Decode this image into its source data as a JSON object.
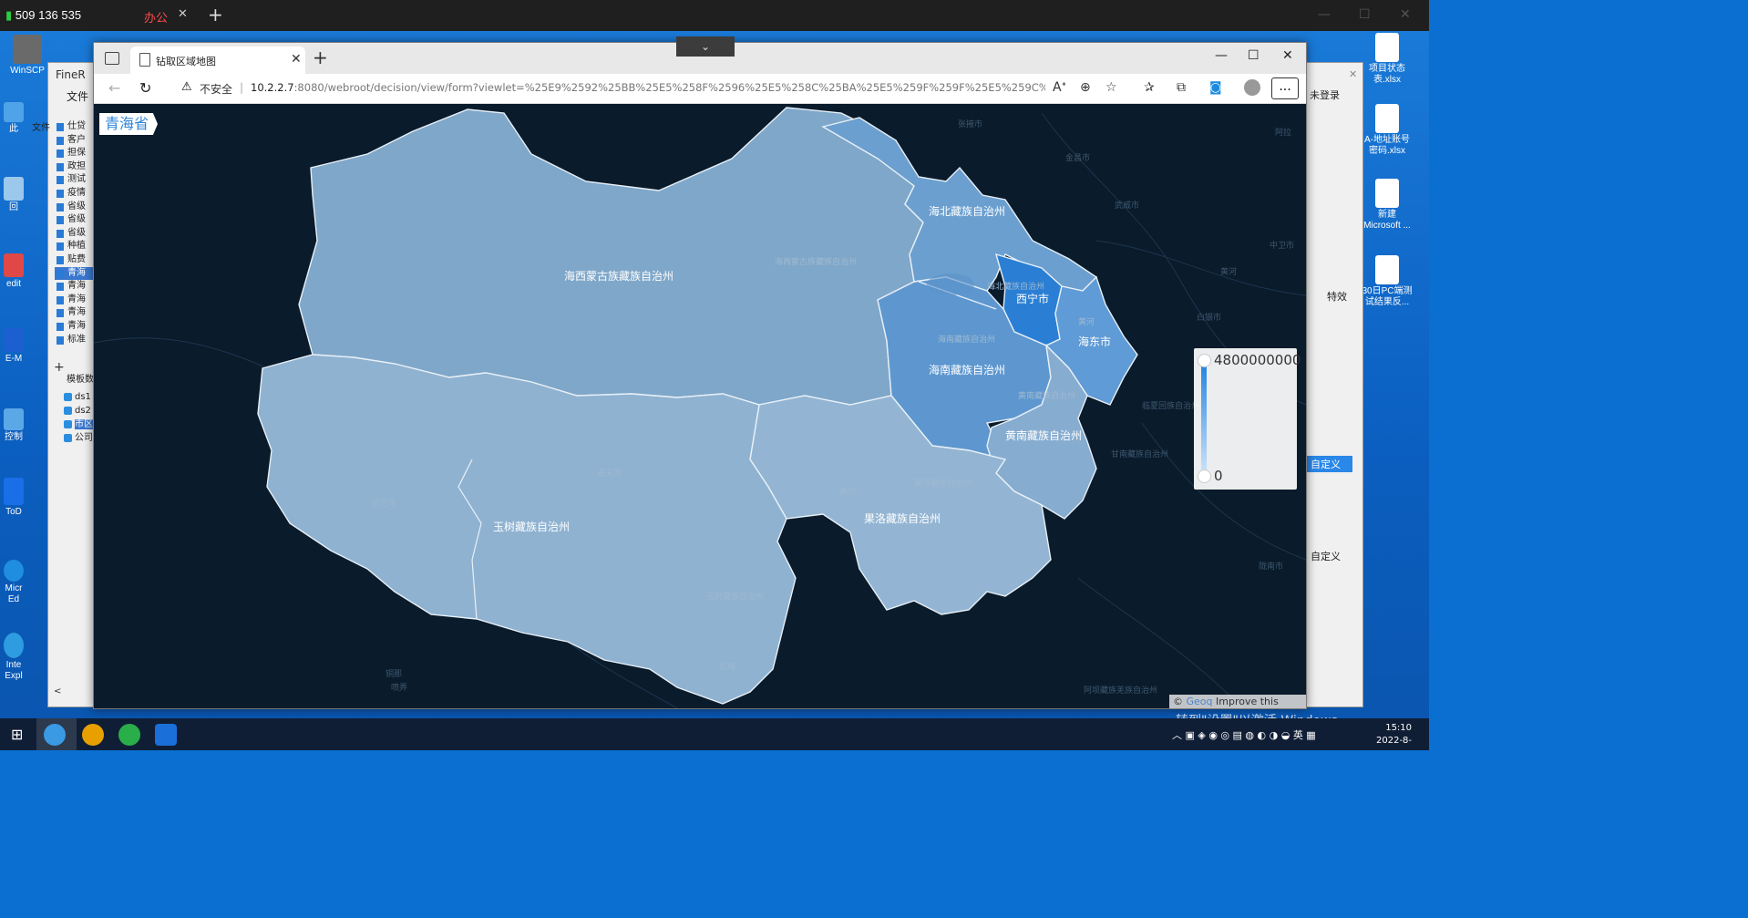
{
  "remote": {
    "session_id": "509 136 535",
    "tab_label": "办公",
    "tab_close": "✕",
    "new_tab": "+"
  },
  "desktop": {
    "left_icons": [
      "WinSCP",
      "此",
      "回",
      "edit",
      "E-M",
      "控制",
      "ToD",
      "Micr Ed",
      "Inte Expl"
    ],
    "right_icons": [
      "项目状态表.xlsx",
      "A-地址账号密码.xlsx",
      "新建 Microsoft ...",
      "30日PC端测试结果反..."
    ]
  },
  "bg_window": {
    "title": "FineR",
    "menu_file": "文件",
    "menu_file2": "文件",
    "tree_items": [
      "仕贷",
      "客户",
      "担保",
      "政担",
      "测试",
      "疫情",
      "省级",
      "省级",
      "省级",
      "种植",
      "贴费",
      "青海",
      "青海",
      "青海",
      "青海",
      "青海",
      "标准"
    ],
    "ds_header": "模板数",
    "ds_items": [
      "ds1",
      "ds2",
      "市区",
      "公司"
    ],
    "right_login": "未登录",
    "right_effect": "特效",
    "right_custom1": "自定义",
    "right_custom2": "自定义"
  },
  "browser": {
    "tab_title": "钻取区域地图",
    "insecure_label": "不安全",
    "separator": "|",
    "url_host": "10.2.2.7",
    "url_rest": ":8080/webroot/decision/view/form?viewlet=%25E9%2592%25BB%25E5%258F%2596%25E5%258C%25BA%25E5%259F%259F%25E5%259C%25B0%25E5%259B%25...",
    "more_label": "..."
  },
  "map": {
    "province_badge": "青海省",
    "regions": [
      {
        "name": "海西蒙古族藏族自治州",
        "color": "#7fa7c9"
      },
      {
        "name": "海北藏族自治州",
        "color": "#6b9fcf"
      },
      {
        "name": "西宁市",
        "color": "#2a7fd4"
      },
      {
        "name": "海东市",
        "color": "#5f9bd6"
      },
      {
        "name": "海南藏族自治州",
        "color": "#5e97cf"
      },
      {
        "name": "黄南藏族自治州",
        "color": "#86acd0"
      },
      {
        "name": "玉树藏族自治州",
        "color": "#8fb2d1"
      },
      {
        "name": "果洛藏族自治州",
        "color": "#93b5d3"
      }
    ],
    "faint_labels": [
      "张掖市",
      "金昌市",
      "武威市",
      "中卫市",
      "白银市",
      "临夏回族自治州",
      "甘南藏族自治州",
      "陇南市",
      "阿坝藏族羌族自治州",
      "阿拉",
      "黄河",
      "通天河",
      "沱沱河",
      "黄河",
      "铜那",
      "喷弄"
    ],
    "inner_faint": [
      "海西蒙古族藏族自治州",
      "海北藏族自治州",
      "西宁市",
      "海东市",
      "海南藏族自治州",
      "黄南藏族自治州",
      "果洛藏族自治州",
      "玉树藏族自治州",
      "扎陵"
    ],
    "legend": {
      "max": "4800000000",
      "min": "0"
    },
    "attribution_prefix": "© ",
    "attribution_geoq": "Geoq",
    "attribution_rest": " Improve this map"
  },
  "system": {
    "watermark": "转到\"设置\"以激活 Windows。",
    "tray_lang": "英",
    "time": "15:10",
    "date": "2022-8-"
  }
}
